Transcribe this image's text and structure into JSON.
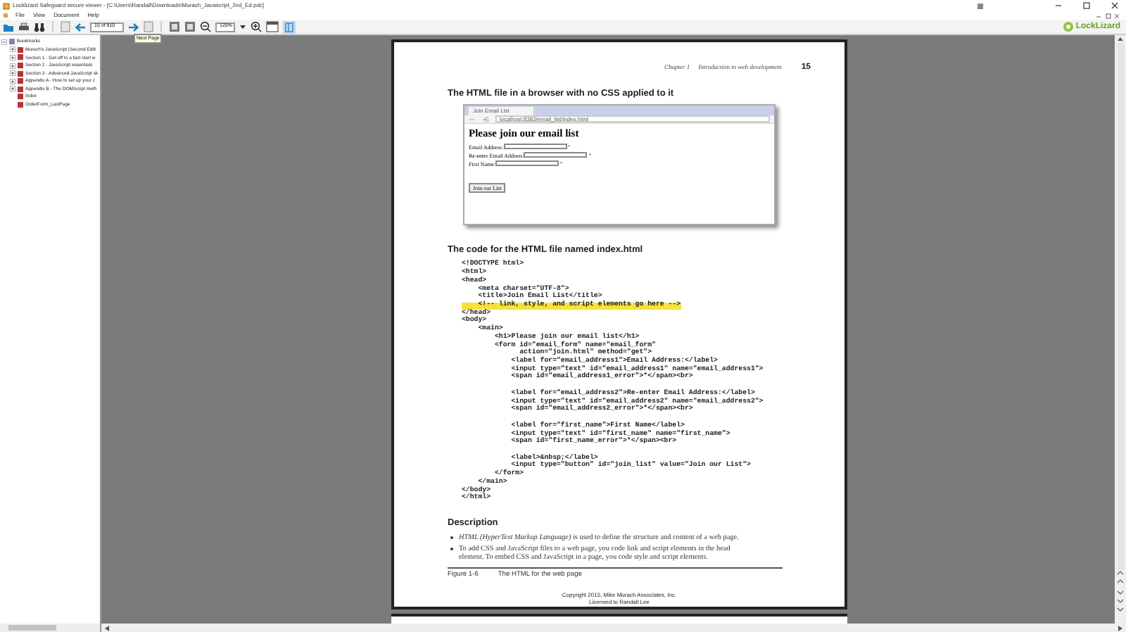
{
  "window": {
    "title": "Locklizard Safeguard secure viewer - [C:\\Users\\Randall\\Downloads\\Murach_Javascript_2nd_Ed.pdc]"
  },
  "menu": [
    "File",
    "View",
    "Document",
    "Help"
  ],
  "toolbar": {
    "page_field": "15 of 910",
    "zoom_field": "120%",
    "tooltip": "Next Page",
    "logo": "LockLizard"
  },
  "sidebar": {
    "root": {
      "label": "Bookmarks",
      "expanded": true,
      "children": [
        {
          "label": "Murach's JavaScript (Second Editi",
          "expanded": false
        },
        {
          "label": "Section 1 - Get off to a fast start w",
          "expanded": false
        },
        {
          "label": "Section 2 - JavaScript essentials",
          "expanded": false
        },
        {
          "label": "Section 3 - Advanced JavaScript sk",
          "expanded": false
        },
        {
          "label": "Appendix A - How to set up your c",
          "expanded": false
        },
        {
          "label": "Appendix B - The DOMScript meth",
          "expanded": false
        },
        {
          "label": "Index"
        },
        {
          "label": "OrderForm_LastPage"
        }
      ]
    }
  },
  "page": {
    "header": {
      "chapter": "Chapter 1",
      "title": "Introduction to web development",
      "number": "15"
    },
    "figure_heading": "The HTML file in a browser with no CSS applied to it",
    "browser": {
      "tab": "Join Email List",
      "url": "localhost:8383/email_list/index.html",
      "heading": "Please join our email list",
      "fields": [
        {
          "label": "Email Address:",
          "mark": "*"
        },
        {
          "label": "Re-enter Email Address:",
          "mark": "*"
        },
        {
          "label": "First Name:",
          "mark": "*"
        }
      ],
      "button": "Join our List"
    },
    "code_heading": "The code for the HTML file named index.html",
    "code": [
      {
        "kind": "code",
        "text": "<!DOCTYPE html>",
        "highlighted": false
      },
      {
        "kind": "code",
        "text": "<html>",
        "highlighted": false
      },
      {
        "kind": "code",
        "text": "<head>",
        "highlighted": false
      },
      {
        "kind": "code",
        "text": "    <meta charset=\"UTF-8\">",
        "highlighted": false
      },
      {
        "kind": "code",
        "text": "    <title>Join Email List</title>",
        "highlighted": false
      },
      {
        "kind": "code",
        "text": "    <!-- link, style, and script elements go here -->",
        "highlighted": true
      },
      {
        "kind": "code",
        "text": "</head>",
        "highlighted": false
      },
      {
        "kind": "code",
        "text": "<body>",
        "highlighted": false
      },
      {
        "kind": "code",
        "text": "    <main>",
        "highlighted": false
      },
      {
        "kind": "code",
        "text": "        <h1>Please join our email list</h1>",
        "highlighted": false
      },
      {
        "kind": "code",
        "text": "        <form id=\"email_form\" name=\"email_form\"",
        "highlighted": false
      },
      {
        "kind": "code",
        "text": "              action=\"join.html\" method=\"get\">",
        "highlighted": false
      },
      {
        "kind": "code",
        "text": "            <label for=\"email_address1\">Email Address:</label>",
        "highlighted": false
      },
      {
        "kind": "code",
        "text": "            <input type=\"text\" id=\"email_address1\" name=\"email_address1\">",
        "highlighted": false
      },
      {
        "kind": "code",
        "text": "            <span id=\"email_address1_error\">*</span><br>",
        "highlighted": false
      },
      {
        "kind": "blank"
      },
      {
        "kind": "code",
        "text": "            <label for=\"email_address2\">Re-enter Email Address:</label>",
        "highlighted": false
      },
      {
        "kind": "code",
        "text": "            <input type=\"text\" id=\"email_address2\" name=\"email_address2\">",
        "highlighted": false
      },
      {
        "kind": "code",
        "text": "            <span id=\"email_address2_error\">*</span><br>",
        "highlighted": false
      },
      {
        "kind": "blank"
      },
      {
        "kind": "code",
        "text": "            <label for=\"first_name\">First Name</label>",
        "highlighted": false
      },
      {
        "kind": "code",
        "text": "            <input type=\"text\" id=\"first_name\" name=\"first_name\">",
        "highlighted": false
      },
      {
        "kind": "code",
        "text": "            <span id=\"first_name_error\">*</span><br>",
        "highlighted": false
      },
      {
        "kind": "blank"
      },
      {
        "kind": "code",
        "text": "            <label>&nbsp;</label>",
        "highlighted": false
      },
      {
        "kind": "code",
        "text": "            <input type=\"button\" id=\"join_list\" value=\"Join our List\">",
        "highlighted": false
      },
      {
        "kind": "code",
        "text": "        </form>",
        "highlighted": false
      },
      {
        "kind": "code",
        "text": "    </main>",
        "highlighted": false
      },
      {
        "kind": "code",
        "text": "</body>",
        "highlighted": false
      },
      {
        "kind": "code",
        "text": "</html>",
        "highlighted": false
      }
    ],
    "description_heading": "Description",
    "bullets": [
      "*HTML (HyperText Markup Language)* is used to define the structure and content of a web  page.",
      "To add CSS and JavaScript files to a web page, you code link and script elements in the head element. To embed CSS and JavaScript in a page, you code style and script elements."
    ],
    "caption": {
      "number": "Figure 1-6",
      "text": "The HTML for the web page"
    },
    "copyright": [
      "Copyright 2015, Mike Murach Associates, Inc.",
      "Licensed to Randall Lee"
    ]
  }
}
